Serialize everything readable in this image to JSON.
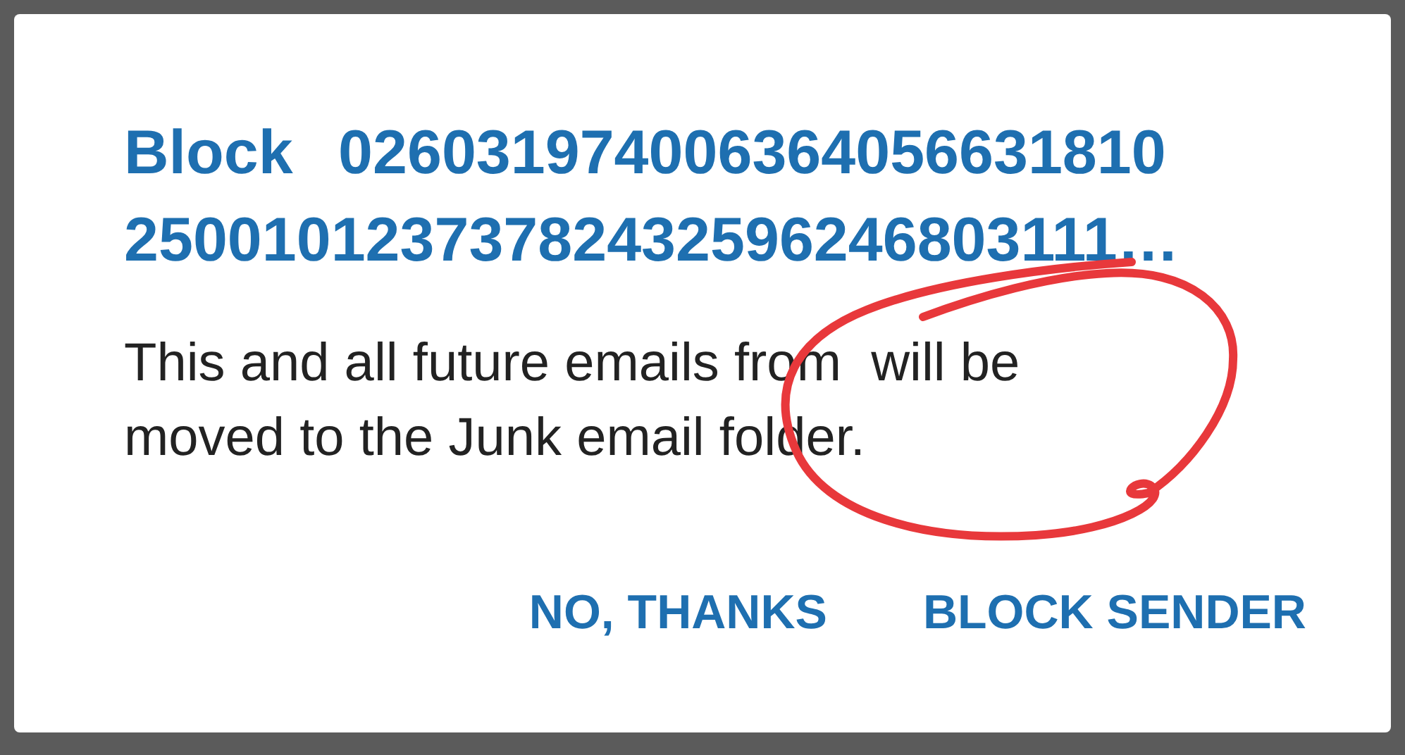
{
  "dialog": {
    "title": "Block 02603197400636405663181025001012373782432596246803111…",
    "message": "This and all future emails from  will be moved to the Junk email folder.",
    "buttons": [
      {
        "label": "NO, THANKS"
      },
      {
        "label": "BLOCK SENDER"
      }
    ]
  },
  "annotation": {
    "kind": "circle",
    "color": "#e8383b"
  }
}
